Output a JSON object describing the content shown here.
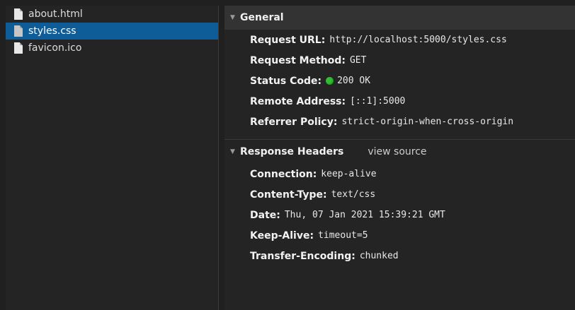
{
  "files": [
    {
      "name": "about.html",
      "selected": false
    },
    {
      "name": "styles.css",
      "selected": true
    },
    {
      "name": "favicon.ico",
      "selected": false
    }
  ],
  "general": {
    "title": "General",
    "rows": [
      {
        "name": "Request URL:",
        "value": "http://localhost:5000/styles.css"
      },
      {
        "name": "Request Method:",
        "value": "GET"
      },
      {
        "name": "Status Code:",
        "value": "200 OK",
        "status_color": "#2fbf2f"
      },
      {
        "name": "Remote Address:",
        "value": "[::1]:5000"
      },
      {
        "name": "Referrer Policy:",
        "value": "strict-origin-when-cross-origin"
      }
    ]
  },
  "response_headers": {
    "title": "Response Headers",
    "view_source": "view source",
    "rows": [
      {
        "name": "Connection:",
        "value": "keep-alive"
      },
      {
        "name": "Content-Type:",
        "value": "text/css"
      },
      {
        "name": "Date:",
        "value": "Thu, 07 Jan 2021 15:39:21 GMT"
      },
      {
        "name": "Keep-Alive:",
        "value": "timeout=5"
      },
      {
        "name": "Transfer-Encoding:",
        "value": "chunked"
      }
    ]
  },
  "icons": {
    "file": "file-icon",
    "expand": "triangle-down-icon",
    "status": "status-dot-icon"
  },
  "colors": {
    "selection": "#0f5d98",
    "status_ok": "#2fbf2f"
  }
}
